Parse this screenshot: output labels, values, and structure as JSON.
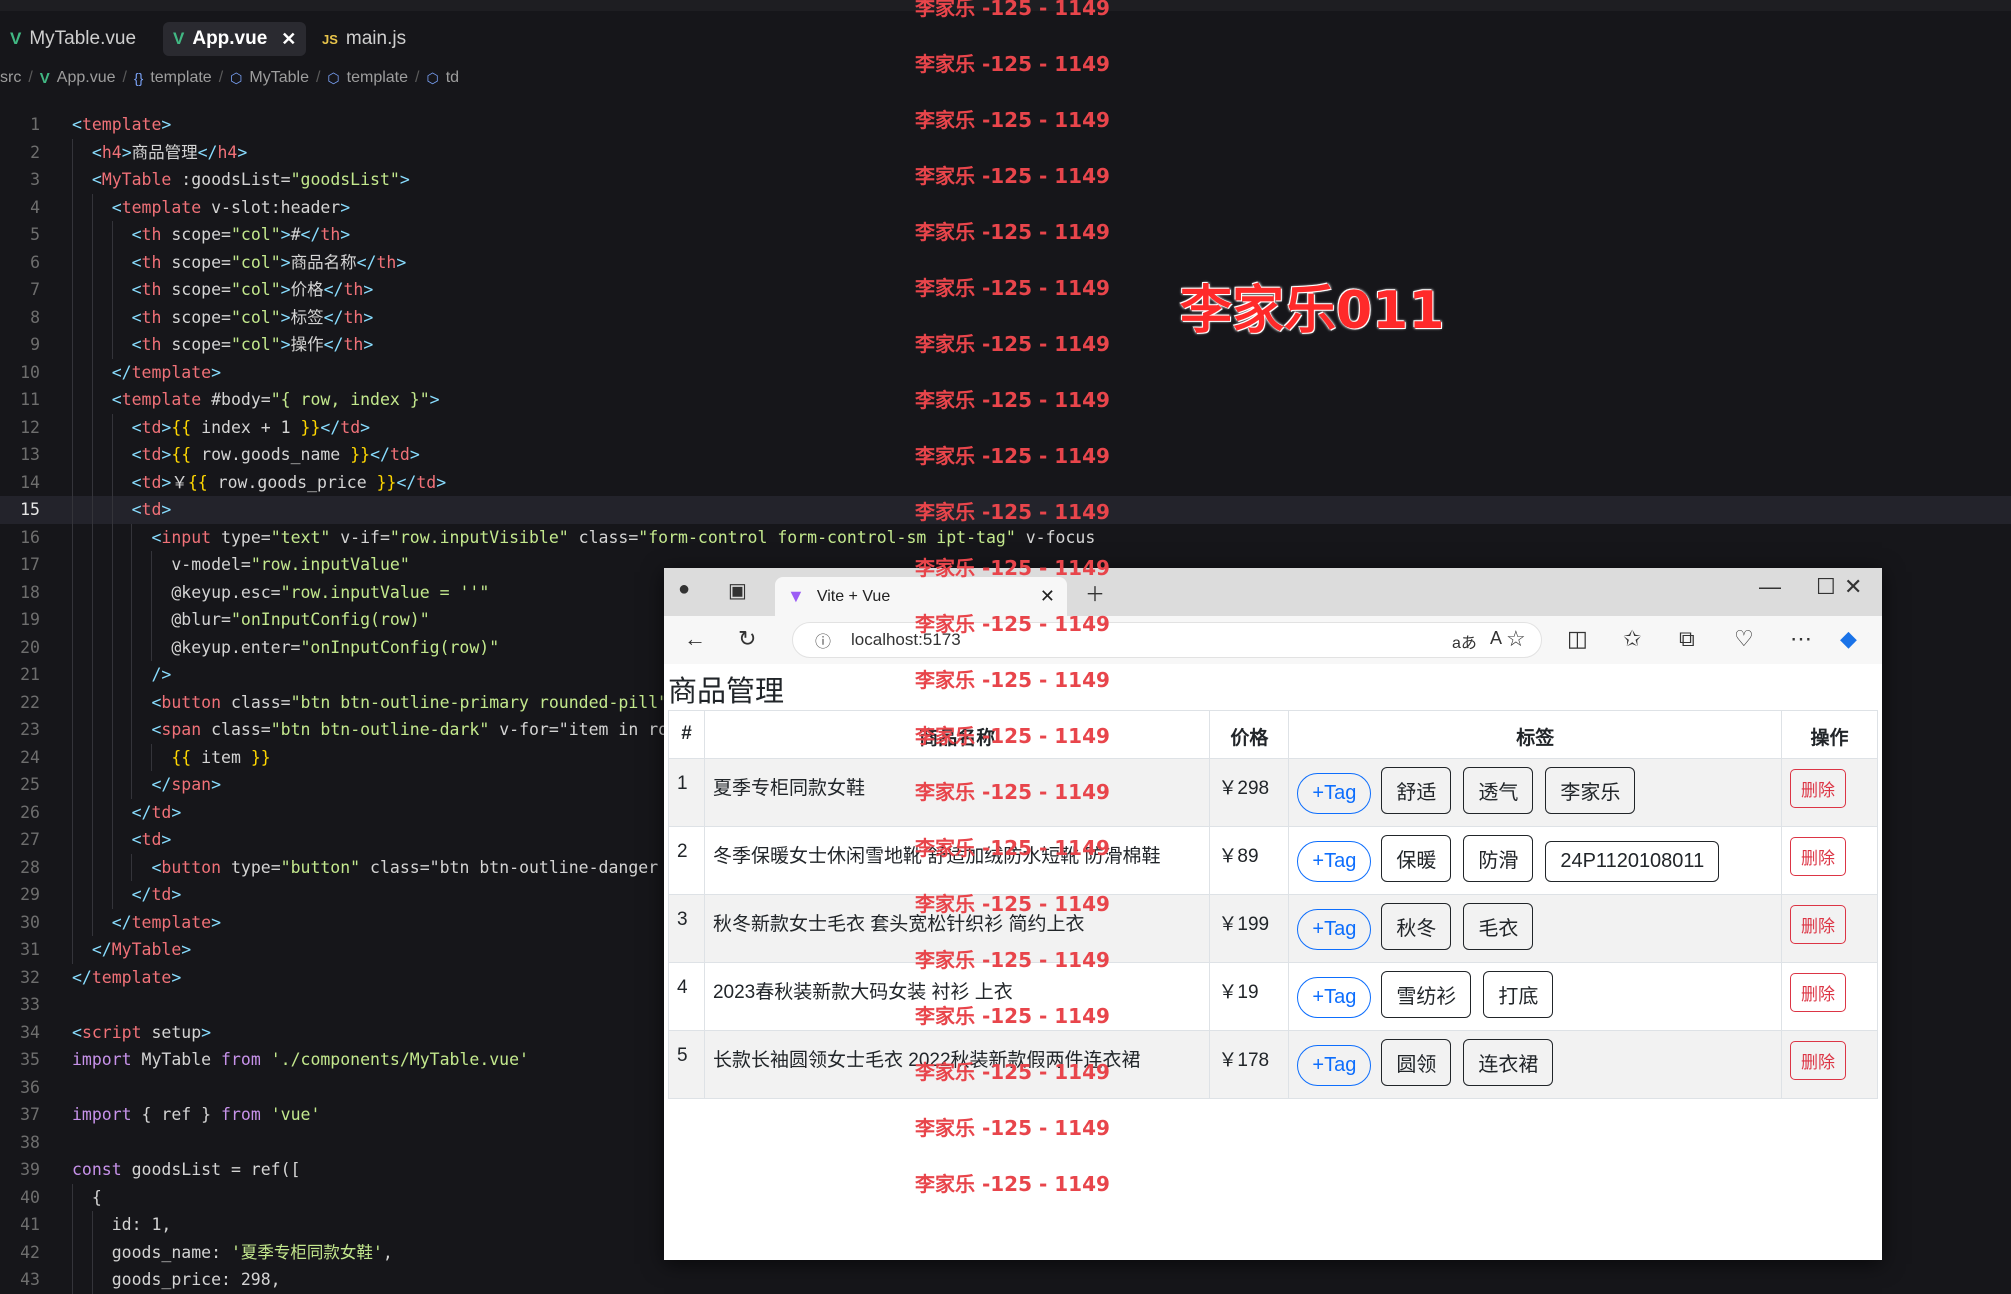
{
  "editor": {
    "tabs": [
      {
        "label": "MyTable.vue",
        "icon": "vue-icon",
        "active": false
      },
      {
        "label": "App.vue",
        "icon": "vue-icon",
        "active": true
      },
      {
        "label": "main.js",
        "icon": "js-icon",
        "active": false
      }
    ],
    "breadcrumb": [
      "src",
      "App.vue",
      "template",
      "MyTable",
      "template",
      "td"
    ],
    "current_line": 15,
    "lines": [
      "<template>",
      "  <h4>商品管理</h4>",
      "  <MyTable :goodsList=\"goodsList\">",
      "    <template v-slot:header>",
      "      <th scope=\"col\">#</th>",
      "      <th scope=\"col\">商品名称</th>",
      "      <th scope=\"col\">价格</th>",
      "      <th scope=\"col\">标签</th>",
      "      <th scope=\"col\">操作</th>",
      "    </template>",
      "    <template #body=\"{ row, index }\">",
      "      <td>{{ index + 1 }}</td>",
      "      <td>{{ row.goods_name }}</td>",
      "      <td>￥{{ row.goods_price }}</td>",
      "      <td>",
      "        <input type=\"text\" v-if=\"row.inputVisible\" class=\"form-control form-control-sm ipt-tag\" v-focus",
      "          v-model=\"row.inputValue\"",
      "          @keyup.esc=\"row.inputValue = ''\"",
      "          @blur=\"onInputConfig(row)\"",
      "          @keyup.enter=\"onInputConfig(row)\"",
      "        />",
      "        <button class=\"btn btn-outline-primary rounded-pill\"",
      "        <span class=\"btn btn-outline-dark\" v-for=\"item in row",
      "          {{ item }}",
      "        </span>",
      "      </td>",
      "      <td>",
      "        <button type=\"button\" class=\"btn btn-outline-danger b",
      "      </td>",
      "    </template>",
      "  </MyTable>",
      "</template>",
      "",
      "<script setup>",
      "import MyTable from './components/MyTable.vue'",
      "",
      "import { ref } from 'vue'",
      "",
      "const goodsList = ref([",
      "  {",
      "    id: 1,",
      "    goods_name: '夏季专柜同款女鞋',",
      "    goods_price: 298,"
    ]
  },
  "watermark": {
    "repeat_text": "李家乐 -125 - 1149",
    "big_text": "李家乐011"
  },
  "browser": {
    "tab_title": "Vite + Vue",
    "url": "localhost:5173",
    "page_title": "商品管理",
    "table": {
      "headers": [
        "#",
        "商品名称",
        "价格",
        "标签",
        "操作"
      ],
      "add_tag_label": "+Tag",
      "delete_label": "删除",
      "rows": [
        {
          "index": "1",
          "name": "夏季专柜同款女鞋",
          "price": "￥298",
          "tags": [
            "舒适",
            "透气",
            "李家乐"
          ]
        },
        {
          "index": "2",
          "name": "冬季保暖女士休闲雪地靴 舒适加绒防水短靴 防滑棉鞋",
          "price": "￥89",
          "tags": [
            "保暖",
            "防滑",
            "24P1120108011"
          ]
        },
        {
          "index": "3",
          "name": "秋冬新款女士毛衣 套头宽松针织衫 简约上衣",
          "price": "￥199",
          "tags": [
            "秋冬",
            "毛衣"
          ]
        },
        {
          "index": "4",
          "name": "2023春秋装新款大码女装 衬衫 上衣",
          "price": "￥19",
          "tags": [
            "雪纺衫",
            "打底"
          ]
        },
        {
          "index": "5",
          "name": "长款长袖圆领女士毛衣 2022秋装新款假两件连衣裙",
          "price": "￥178",
          "tags": [
            "圆领",
            "连衣裙"
          ]
        }
      ]
    }
  },
  "colors": {
    "primary": "#0d6efd",
    "danger": "#dc3545",
    "editor_bg": "#16161a",
    "watermark": "#e8454b"
  }
}
